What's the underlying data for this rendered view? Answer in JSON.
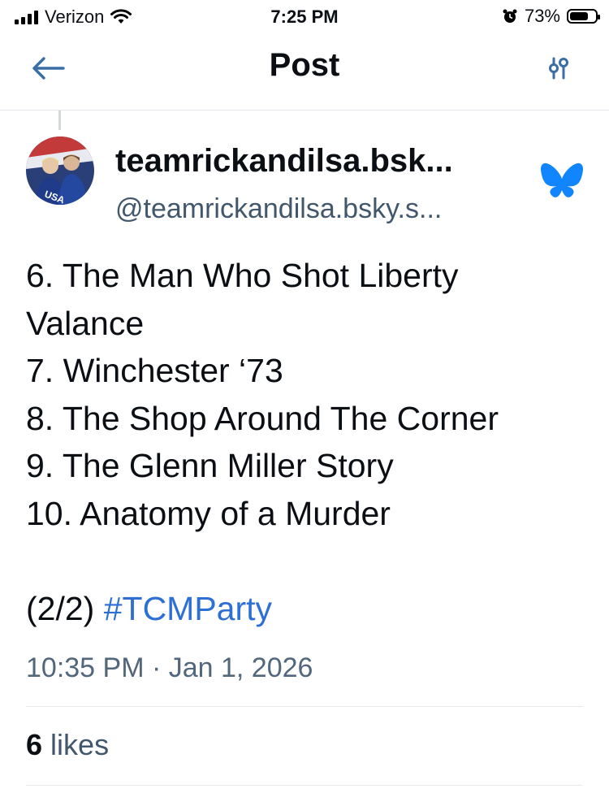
{
  "status_bar": {
    "carrier": "Verizon",
    "time": "7:25 PM",
    "battery_percent": "73%",
    "battery_level": 0.73,
    "icons": [
      "signal-icon",
      "wifi-icon",
      "alarm-icon",
      "battery-icon"
    ]
  },
  "header": {
    "title": "Post",
    "back_icon": "arrow-left-icon",
    "filter_icon": "sliders-icon"
  },
  "post": {
    "author": {
      "display_name": "teamrickandilsa.bsk...",
      "handle": "@teamrickandilsa.bsky.s...",
      "badge_icon": "bluesky-butterfly-icon"
    },
    "lines": [
      "6. The Man Who Shot Liberty",
      "Valance",
      "7. Winchester ‘73",
      "8. The Shop Around The Corner",
      "9. The Glenn Miller Story",
      "10. Anatomy of a Murder"
    ],
    "footer_prefix": "(2/2)",
    "hashtag": "#TCMParty",
    "timestamp": "10:35 PM · Jan 1, 2026",
    "likes_count": "6",
    "likes_label": "likes"
  },
  "colors": {
    "accent": "#2d6fd3",
    "bluesky": "#1185fe",
    "muted_text": "#42576c",
    "divider": "#e4e7eb"
  }
}
